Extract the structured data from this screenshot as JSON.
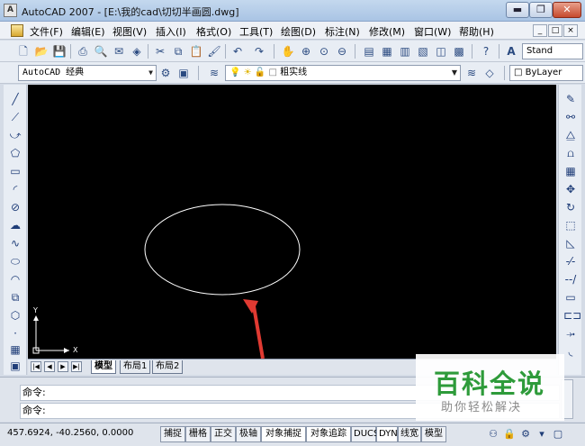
{
  "window": {
    "title": "AutoCAD 2007 - [E:\\我的cad\\切切半画圆.dwg]",
    "icon_label": "A",
    "controls": [
      "minimize-icon",
      "maximize-icon",
      "close-icon"
    ]
  },
  "menu": {
    "items": [
      "文件(F)",
      "编辑(E)",
      "视图(V)",
      "插入(I)",
      "格式(O)",
      "工具(T)",
      "绘图(D)",
      "标注(N)",
      "修改(M)",
      "窗口(W)",
      "帮助(H)"
    ],
    "mdi_controls": [
      "_",
      "□",
      "×"
    ]
  },
  "toolbar1": {
    "icons": [
      "new-icon",
      "open-icon",
      "save-icon",
      "plot-icon",
      "plot-preview-icon",
      "publish-icon",
      "3d-dwf-icon",
      "cut-icon",
      "copy-icon",
      "paste-icon",
      "match-properties-icon",
      "undo-icon",
      "redo-icon",
      "pan-icon",
      "zoom-realtime-icon",
      "zoom-window-icon",
      "zoom-previous-icon",
      "properties-icon",
      "design-center-icon",
      "tool-palettes-icon",
      "sheet-set-icon",
      "markup-icon",
      "quickcalc-icon",
      "help-icon"
    ],
    "text_style_prefix": "A",
    "text_style_value": "Stand"
  },
  "toolbar2": {
    "workspace_value": "AutoCAD 经典",
    "layer_value": "粗实线",
    "color_value": "ByLayer"
  },
  "left_tools": [
    "line-icon",
    "construction-line-icon",
    "polyline-icon",
    "polygon-icon",
    "rectangle-icon",
    "arc-icon",
    "circle-icon",
    "revision-cloud-icon",
    "spline-icon",
    "ellipse-icon",
    "ellipse-arc-icon",
    "insert-block-icon",
    "make-block-icon",
    "point-icon",
    "hatch-icon",
    "gradient-icon"
  ],
  "right_tools": [
    "erase-icon",
    "copy-object-icon",
    "mirror-icon",
    "offset-icon",
    "array-icon",
    "move-icon",
    "rotate-icon",
    "scale-icon",
    "stretch-icon",
    "trim-icon",
    "extend-icon",
    "break-icon",
    "join-icon",
    "chamfer-icon",
    "fillet-icon"
  ],
  "canvas": {
    "ucs_x": "X",
    "ucs_y": "Y"
  },
  "layout_tabs": [
    "模型",
    "布局1",
    "布局2"
  ],
  "command": {
    "line1": "命令:",
    "line2": "命令:"
  },
  "status": {
    "coordinates": "457.6924, -40.2560, 0.0000",
    "buttons": [
      "捕捉",
      "栅格",
      "正交",
      "极轴",
      "对象捕捉",
      "对象追踪",
      "DUCS",
      "DYN",
      "线宽",
      "模型"
    ]
  },
  "watermark": {
    "title": "百科全说",
    "subtitle": "助你轻松解决"
  },
  "colors": {
    "canvas": "#000000",
    "drawing_stroke": "#ffffff",
    "annotation_arrow": "#e03a32",
    "watermark_green": "#2e9b3a"
  }
}
